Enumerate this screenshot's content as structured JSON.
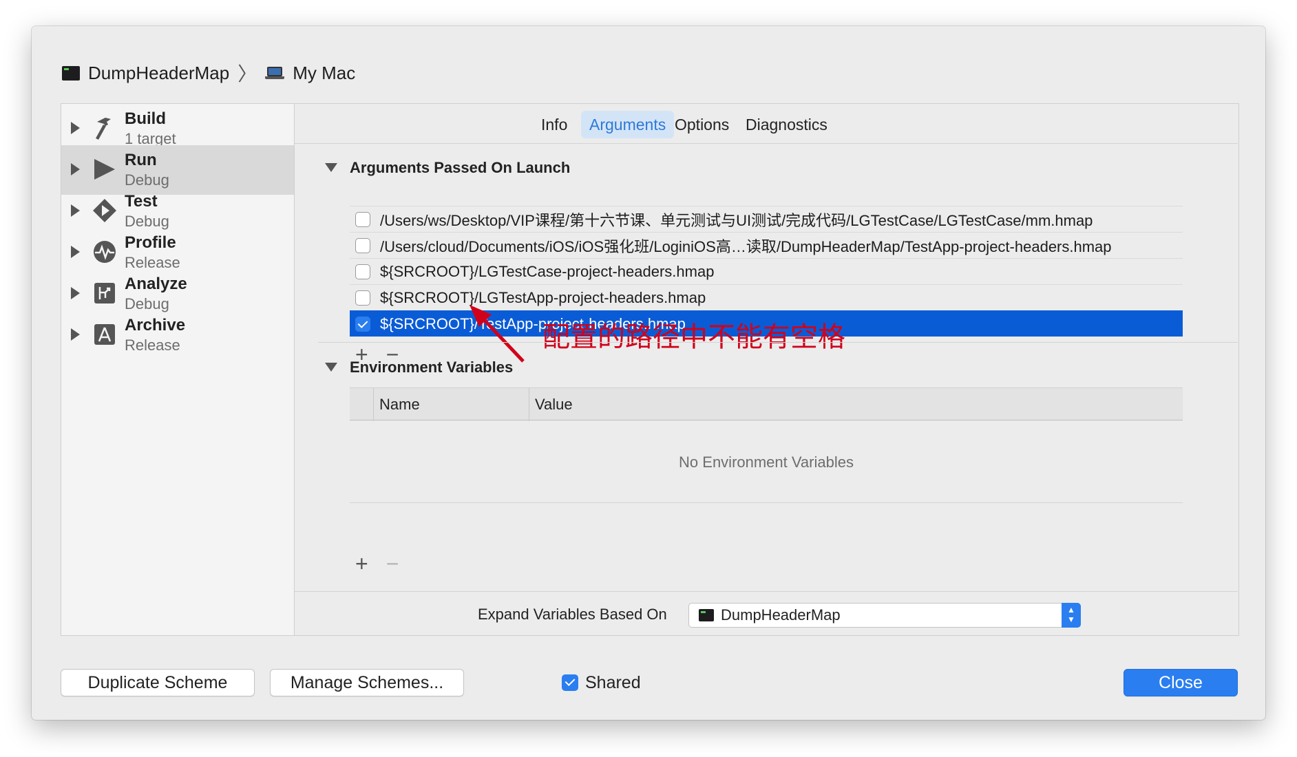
{
  "breadcrumb": {
    "project": "DumpHeaderMap",
    "destination": "My Mac"
  },
  "sidebar": {
    "items": [
      {
        "title": "Build",
        "subtitle": "1 target",
        "icon": "hammer-icon"
      },
      {
        "title": "Run",
        "subtitle": "Debug",
        "icon": "play-icon",
        "selected": true
      },
      {
        "title": "Test",
        "subtitle": "Debug",
        "icon": "test-diamond-icon"
      },
      {
        "title": "Profile",
        "subtitle": "Release",
        "icon": "instruments-icon"
      },
      {
        "title": "Analyze",
        "subtitle": "Debug",
        "icon": "analyze-icon"
      },
      {
        "title": "Archive",
        "subtitle": "Release",
        "icon": "archive-icon"
      }
    ]
  },
  "tabs": [
    "Info",
    "Arguments",
    "Options",
    "Diagnostics"
  ],
  "active_tab": "Arguments",
  "arguments_section": {
    "title": "Arguments Passed On Launch",
    "items": [
      {
        "text": "/Users/ws/Desktop/VIP课程/第十六节课、单元测试与UI测试/完成代码/LGTestCase/LGTestCase/mm.hmap",
        "checked": false
      },
      {
        "text": "/Users/cloud/Documents/iOS/iOS强化班/LoginiOS高…读取/DumpHeaderMap/TestApp-project-headers.hmap",
        "checked": false
      },
      {
        "text": "${SRCROOT}/LGTestCase-project-headers.hmap",
        "checked": false
      },
      {
        "text": "${SRCROOT}/LGTestApp-project-headers.hmap",
        "checked": false
      },
      {
        "text": "${SRCROOT}/TestApp-project-headers.hmap",
        "checked": true,
        "selected": true
      }
    ],
    "add_label": "+",
    "remove_label": "−"
  },
  "annotation": "配置的路径中不能有空格",
  "env_section": {
    "title": "Environment Variables",
    "columns": [
      "Name",
      "Value"
    ],
    "empty_text": "No Environment Variables",
    "add_label": "+",
    "remove_label": "−"
  },
  "expand": {
    "label": "Expand Variables Based On",
    "value": "DumpHeaderMap"
  },
  "footer": {
    "duplicate": "Duplicate Scheme",
    "manage": "Manage Schemes...",
    "shared_label": "Shared",
    "shared_checked": true,
    "close": "Close"
  },
  "colors": {
    "accent": "#2a7ef0",
    "selection": "#0a5cd6",
    "annotation": "#d0021b"
  }
}
